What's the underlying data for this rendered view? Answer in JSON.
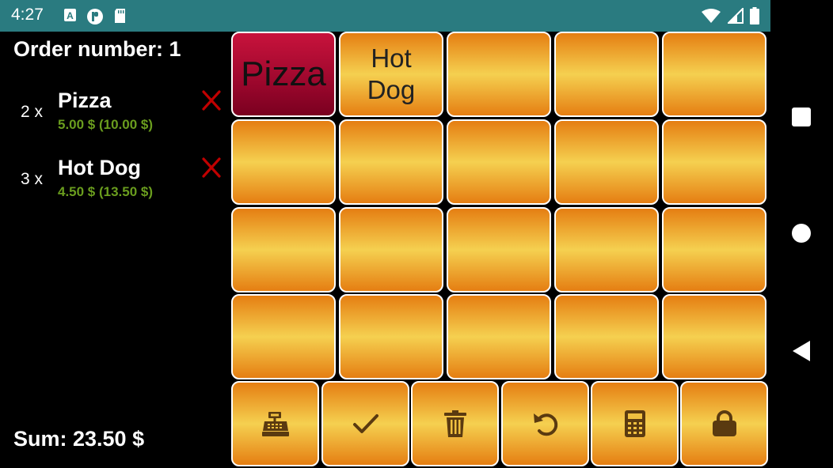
{
  "status_bar": {
    "time": "4:27",
    "left_icons": [
      "a-box-icon",
      "p-circle-icon",
      "sd-card-icon"
    ],
    "right_icons": [
      "wifi-icon",
      "signal-icon",
      "battery-icon"
    ]
  },
  "order": {
    "title": "Order number: 1",
    "items": [
      {
        "qty": "2 x",
        "name": "Pizza",
        "price": "5.00 $ (10.00 $)"
      },
      {
        "qty": "3 x",
        "name": "Hot Dog",
        "price": "4.50 $ (13.50 $)"
      }
    ],
    "sum": "Sum: 23.50 $"
  },
  "products": [
    {
      "label": "Pizza",
      "selected": true
    },
    {
      "label": "Hot\nDog",
      "selected": false
    },
    {
      "label": "",
      "selected": false
    },
    {
      "label": "",
      "selected": false
    },
    {
      "label": "",
      "selected": false
    },
    {
      "label": "",
      "selected": false
    },
    {
      "label": "",
      "selected": false
    },
    {
      "label": "",
      "selected": false
    },
    {
      "label": "",
      "selected": false
    },
    {
      "label": "",
      "selected": false
    },
    {
      "label": "",
      "selected": false
    },
    {
      "label": "",
      "selected": false
    },
    {
      "label": "",
      "selected": false
    },
    {
      "label": "",
      "selected": false
    },
    {
      "label": "",
      "selected": false
    },
    {
      "label": "",
      "selected": false
    },
    {
      "label": "",
      "selected": false
    },
    {
      "label": "",
      "selected": false
    },
    {
      "label": "",
      "selected": false
    },
    {
      "label": "",
      "selected": false
    }
  ],
  "actions": [
    {
      "name": "cash-register",
      "icon": "cash-register-icon"
    },
    {
      "name": "confirm",
      "icon": "check-icon"
    },
    {
      "name": "delete",
      "icon": "trash-icon"
    },
    {
      "name": "undo",
      "icon": "undo-icon"
    },
    {
      "name": "calculator",
      "icon": "calculator-icon"
    },
    {
      "name": "lock",
      "icon": "lock-icon"
    }
  ],
  "nav": [
    "square-icon",
    "circle-icon",
    "back-triangle-icon"
  ],
  "colors": {
    "status_bar": "#2a7b80",
    "tile_orange": "#e57e12",
    "tile_yellow": "#f5d050",
    "tile_selected": "#a0082e",
    "price_green": "#6a9d1e",
    "remove_red": "#c00000",
    "icon_brown": "#5a3a10"
  }
}
